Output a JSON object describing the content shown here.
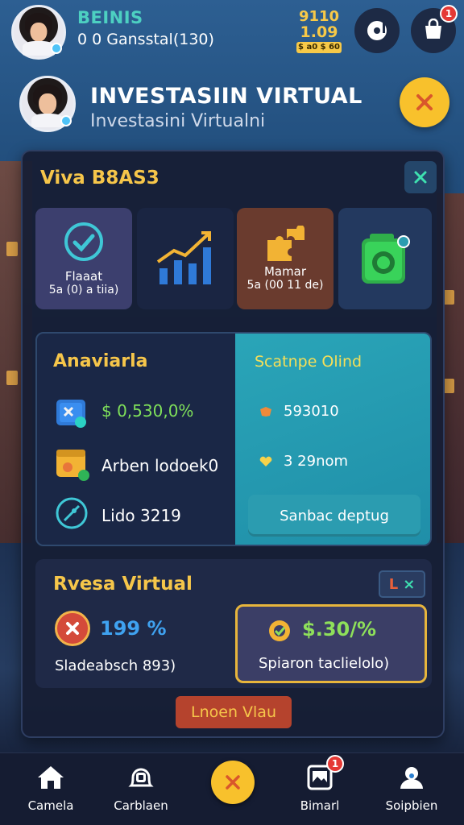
{
  "header": {
    "user_name": "BEINIS",
    "user_sub": "0 0 Gansstal(130)",
    "coins_top": "9110",
    "coins_mid": "1.09",
    "coins_tag": "$ a0 $ 60",
    "notif_count": "1"
  },
  "hero": {
    "title": "INVESTASIIN VIRTUAL",
    "subtitle": "Investasini Virtualni"
  },
  "panel": {
    "title": "Viva B8AS3",
    "tiles": [
      {
        "label": "Flaaat",
        "value": "5a (0) a tiia)"
      },
      {
        "label": "",
        "value": ""
      },
      {
        "label": "Mamar",
        "value": "5a (00 11 de)"
      },
      {
        "label": "",
        "value": ""
      }
    ],
    "info": {
      "left_title": "Anaviarla",
      "rows": [
        {
          "text": "$ 0,530,0%",
          "color": "#7fe05a"
        },
        {
          "text": "Arben lodoek0",
          "color": "#ffffff"
        },
        {
          "text": "Lido 3219",
          "color": "#ffffff"
        }
      ],
      "right_title": "Scatnpe Olind",
      "right_rows": [
        {
          "text": "593010"
        },
        {
          "text": "3 29nom"
        }
      ],
      "right_button": "Sanbac deptug"
    },
    "section2": {
      "title": "Rvesa Virtual",
      "chip_left": "L",
      "chip_right": "×",
      "left_pct": "199 %",
      "left_label": "Sladeabsch 893)",
      "right_pct": "$.30/%",
      "right_label": "Spiaron taclielolo)"
    },
    "cta_label": "Lnoen Vlau"
  },
  "nav": {
    "items": [
      {
        "label": "Camela",
        "icon": "home-icon"
      },
      {
        "label": "Carblaen",
        "icon": "bell-icon"
      },
      {
        "label": "Bimarl",
        "icon": "image-icon",
        "badge": "1"
      },
      {
        "label": "Soipbien",
        "icon": "profile-icon"
      }
    ]
  },
  "colors": {
    "accent_yellow": "#f8c12c",
    "title_gold": "#f6c64a",
    "teal": "#2aa5b8",
    "green": "#7fe05a",
    "blue_pct": "#3fa2f0"
  }
}
